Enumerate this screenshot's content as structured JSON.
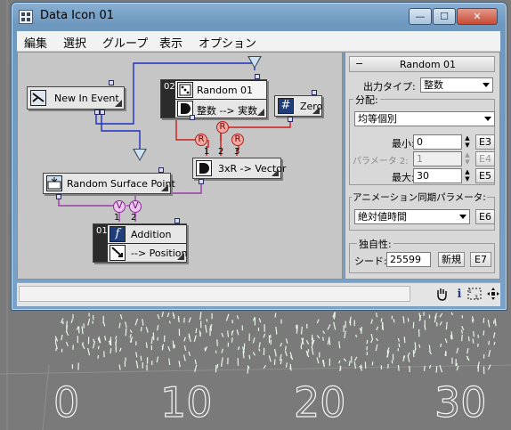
{
  "window": {
    "title": "Data Icon 01",
    "btn_min": "—",
    "btn_max": "☐",
    "btn_close": "✕"
  },
  "menu": [
    "編集",
    "選択",
    "グループ",
    "表示",
    "オプション"
  ],
  "nodes": {
    "new_in_event": {
      "label": "New In Event"
    },
    "random": {
      "num": "02",
      "label": "Random 01",
      "sub": "整数 --> 実数"
    },
    "zero": {
      "label": "Zero"
    },
    "surface": {
      "label": "Random Surface Point"
    },
    "vector": {
      "label": "3xR -> Vector"
    },
    "addition": {
      "num": "01",
      "label": "Addition",
      "sub": "--> Position"
    }
  },
  "ops": {
    "r": "R",
    "v": "V"
  },
  "port_labels": {
    "one": "1",
    "two": "2",
    "three": "3"
  },
  "panel": {
    "header": "Random 01",
    "collapse": "−",
    "output_type_label": "出力タイプ:",
    "output_type_value": "整数",
    "distribution_group": "分配:",
    "distribution_value": "均等個別",
    "min_label": "最小:",
    "min_value": "0",
    "param2_label": "パラメータ 2:",
    "param2_value": "1",
    "max_label": "最大:",
    "max_value": "30",
    "e3": "E3",
    "e4": "E4",
    "e5": "E5",
    "anim_group": "アニメーション同期パラメータ:",
    "anim_value": "絶対値時間",
    "e6": "E6",
    "unique_group": "独自性:",
    "seed_label": "シード:",
    "seed_value": "25599",
    "new_button": "新規",
    "e7": "E7"
  },
  "statusbar": {
    "icons": [
      "hand-icon",
      "info-icon",
      "scale-icon",
      "move-icon"
    ]
  },
  "viewport": {
    "labels": [
      "0",
      "10",
      "20",
      "30"
    ]
  },
  "colors": {
    "wire_blue": "#1b2fc4",
    "wire_red": "#d11a1a",
    "wire_purple": "#9a3aa8",
    "titlebar": "#7aa2c8"
  }
}
